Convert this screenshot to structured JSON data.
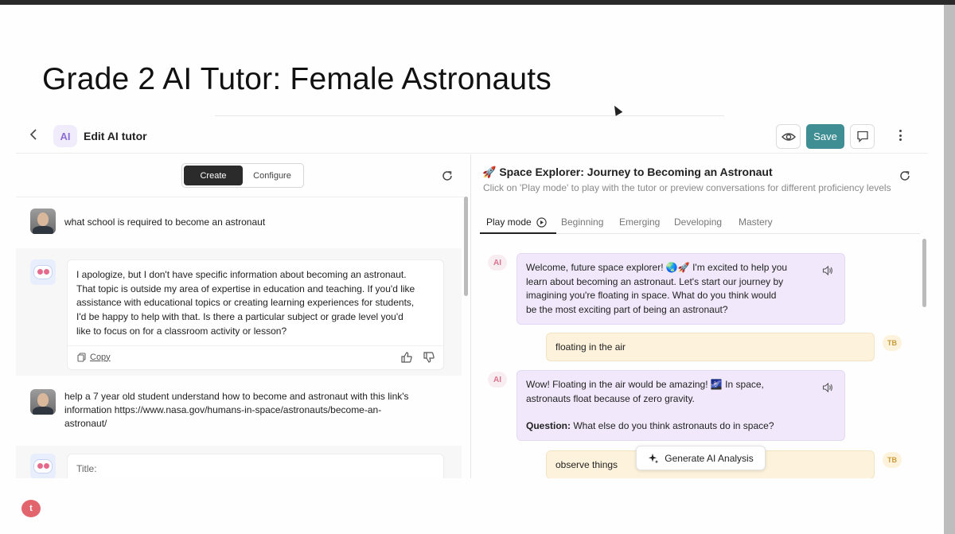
{
  "slide": {
    "title": "Grade 2 AI Tutor: Female Astronauts"
  },
  "header": {
    "ai_badge": "AI",
    "title": "Edit AI tutor",
    "save_label": "Save"
  },
  "left_panel": {
    "tabs": [
      "Create",
      "Configure"
    ],
    "messages": [
      {
        "role": "user",
        "text": "what school is required to become an astronaut"
      },
      {
        "role": "bot",
        "lines": [
          "I apologize, but I don't have specific information about becoming an astronaut.",
          "That topic is outside my area of expertise in education and teaching. If you'd like",
          "assistance with educational topics or creating learning experiences for students,",
          "I'd be happy to help with that. Is there a particular subject or grade level you'd",
          "like to focus on for a classroom activity or lesson?"
        ],
        "copy_label": "Copy"
      },
      {
        "role": "user",
        "lines": [
          "help a 7 year old student understand how to become and astronaut with this link's",
          "information https://www.nasa.gov/humans-in-space/astronauts/become-an-",
          "astronaut/"
        ]
      },
      {
        "role": "bot",
        "partial_text": "Title:"
      }
    ]
  },
  "right_panel": {
    "title": "🚀 Space Explorer: Journey to Becoming an Astronaut",
    "subtitle": "Click on 'Play mode' to play with the tutor or preview conversations for different proficiency levels",
    "tabs": [
      "Play mode",
      "Beginning",
      "Emerging",
      "Developing",
      "Mastery"
    ],
    "ai_tag": "AI",
    "user_tag": "TB",
    "chat": {
      "ai_1": [
        "Welcome, future space explorer! 🌏🚀 I'm excited to help you",
        "learn about becoming an astronaut. Let's start our journey by",
        "imagining you're floating in space. What do you think would",
        "be the most exciting part of being an astronaut?"
      ],
      "user_1": "floating in the air",
      "ai_2": [
        "Wow! Floating in the air would be amazing! 🌌 In space,",
        "astronauts float because of zero gravity."
      ],
      "ai_2_question_label": "Question:",
      "ai_2_question": " What else do you think astronauts do in space?",
      "user_2": "observe things"
    },
    "generate_label": "Generate AI Analysis"
  },
  "bottom_badge": "t",
  "colors": {
    "save": "#3e8e94",
    "ai_bubble": "#f1e9fb",
    "user_bubble": "#fdf3dc",
    "accent_purple": "#8b6fd6"
  }
}
